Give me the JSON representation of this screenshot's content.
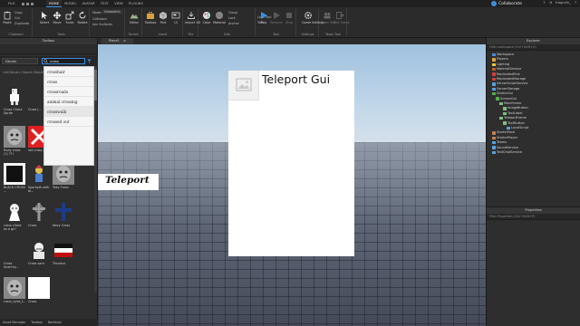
{
  "menubar": {
    "tabs": [
      "FILE",
      "HOME",
      "MODEL",
      "AVATAR",
      "TEST",
      "VIEW",
      "PLUGINS"
    ],
    "active_tab": "HOME",
    "collaborate_label": "Collaborate",
    "user_label": "fragm2k_"
  },
  "ribbon": {
    "clipboard": {
      "paste": "Paste",
      "copy": "Copy",
      "cut": "Cut",
      "duplicate": "Duplicate",
      "group_label": "Clipboard"
    },
    "tools": {
      "select": "Select",
      "move": "Move",
      "scale": "Scale",
      "rotate": "Rotate",
      "group_label": "Tools"
    },
    "mode": {
      "mode_label": "Mode:",
      "mode_value": "Geometric",
      "collisions": "Collisions",
      "join_surfaces": "Join Surfaces"
    },
    "terrain": {
      "editor": "Editor",
      "group_label": "Terrain"
    },
    "insert": {
      "toolbox": "Toolbox",
      "part": "Part",
      "ui": "UI",
      "group_label": "Insert"
    },
    "file": {
      "import3d": "Import 3D",
      "group_label": "File"
    },
    "edit": {
      "color": "Color",
      "material": "Material",
      "group_label": "Edit"
    },
    "misc": {
      "group": "Group",
      "lock": "Lock",
      "anchor": "Anchor",
      "lock_tool": "Lock Tool",
      "text": "Text"
    },
    "test": {
      "play": "Play",
      "resume": "Resume",
      "stop": "Stop",
      "group_label": "Test"
    },
    "settings": {
      "game_settings": "Game Settings",
      "group_label": "Settings"
    },
    "team_test": {
      "team_test": "Team Test",
      "exit_game": "Exit Game",
      "group_label": "Team Test"
    }
  },
  "toolbox": {
    "title": "Toolbox",
    "category": "Decals",
    "search_value": "cross",
    "results_label": "<All Decals / Search Results",
    "suggestions": [
      "crosshair",
      "cross",
      "crossroads",
      "animal crossing",
      "crosswalk",
      "crossed out"
    ],
    "items": [
      {
        "caption": "Cross Chara Sprite",
        "kind": "sprite"
      },
      {
        "caption": "Cross J...",
        "kind": "dark"
      },
      {
        "caption": "Image/crow Red cross",
        "kind": "plain"
      },
      {
        "caption": "Rudy cross (1) ??!",
        "kind": "face"
      },
      {
        "caption": "red cross go",
        "kind": "redx"
      },
      {
        "caption": "Crossed Swords",
        "kind": "swords"
      },
      {
        "caption": "BLACK CROSS ...",
        "kind": "blackbox"
      },
      {
        "caption": "Sparkyth with bl...",
        "kind": "character"
      },
      {
        "caption": "Toky Cross",
        "kind": "face"
      },
      {
        "caption": "cross chara as a girl",
        "kind": "girl"
      },
      {
        "caption": "Cross",
        "kind": "celtic"
      },
      {
        "caption": "Navy Cross",
        "kind": "navycross"
      },
      {
        "caption": "Cross Anarchy...",
        "kind": "dark"
      },
      {
        "caption": "Cross sans",
        "kind": "sans"
      },
      {
        "caption": "Tricolour",
        "kind": "flag"
      },
      {
        "caption": "cross_eyes_t...",
        "kind": "face"
      },
      {
        "caption": "Cross",
        "kind": "plain"
      }
    ],
    "bottom_tabs": [
      "Asset Manager",
      "Toolbox",
      "Backtool"
    ]
  },
  "viewport": {
    "tab_label": "Place1",
    "gui_title": "Teleport Gui",
    "teleport_label": "Teleport"
  },
  "explorer": {
    "title": "Explorer",
    "filter_placeholder": "Filter workspace (Ctrl+Shift+X)",
    "items": [
      {
        "label": "Workspace",
        "indent": 0,
        "color": "#4a90d9"
      },
      {
        "label": "Players",
        "indent": 0,
        "color": "#e0a040"
      },
      {
        "label": "Lighting",
        "indent": 0,
        "color": "#e8c840"
      },
      {
        "label": "MaterialService",
        "indent": 0,
        "color": "#c06030"
      },
      {
        "label": "ReplicatedFirst",
        "indent": 0,
        "color": "#d04040"
      },
      {
        "label": "ReplicatedStorage",
        "indent": 0,
        "color": "#d04040"
      },
      {
        "label": "ServerScriptService",
        "indent": 0,
        "color": "#5aa0e0"
      },
      {
        "label": "ServerStorage",
        "indent": 0,
        "color": "#5aa0e0"
      },
      {
        "label": "StarterGui",
        "indent": 0,
        "color": "#50b050"
      },
      {
        "label": "ScreenGui",
        "indent": 1,
        "color": "#50b050"
      },
      {
        "label": "MainFrame",
        "indent": 2,
        "color": "#80c080"
      },
      {
        "label": "ImageButton",
        "indent": 3,
        "color": "#80c080"
      },
      {
        "label": "TextLabel",
        "indent": 3,
        "color": "#80c080"
      },
      {
        "label": "TeleportFrame",
        "indent": 2,
        "color": "#80c080"
      },
      {
        "label": "TextButton",
        "indent": 3,
        "color": "#80c080"
      },
      {
        "label": "LocalScript",
        "indent": 4,
        "color": "#5aa0e0"
      },
      {
        "label": "StarterPack",
        "indent": 0,
        "color": "#c08050"
      },
      {
        "label": "StarterPlayer",
        "indent": 0,
        "color": "#c08050"
      },
      {
        "label": "Teams",
        "indent": 0,
        "color": "#5aa0e0"
      },
      {
        "label": "SoundService",
        "indent": 0,
        "color": "#5aa0e0"
      },
      {
        "label": "TextChatService",
        "indent": 0,
        "color": "#5aa0e0"
      }
    ]
  },
  "properties": {
    "title": "Properties",
    "filter_placeholder": "Filter Properties (Ctrl+Shift+P)"
  }
}
